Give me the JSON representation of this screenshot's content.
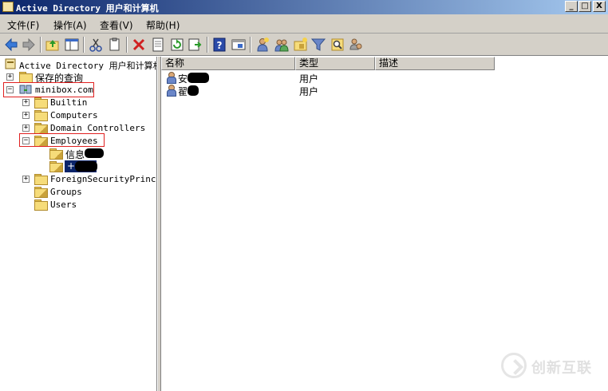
{
  "window": {
    "title": "Active Directory 用户和计算机",
    "buttons": {
      "minimize": "_",
      "maximize": "□",
      "close": "X"
    }
  },
  "menu": [
    "文件(F)",
    "操作(A)",
    "查看(V)",
    "帮助(H)"
  ],
  "toolbar": {
    "icons": [
      "back-arrow-icon",
      "forward-arrow-icon",
      "up-folder-icon",
      "show-hide-tree-icon",
      "cut-icon",
      "copy-icon",
      "delete-icon",
      "properties-icon",
      "refresh-icon",
      "export-list-icon",
      "help-icon",
      "mmc-console-icon",
      "new-user-icon",
      "new-group-icon",
      "new-ou-icon",
      "filter-icon",
      "find-icon",
      "add-to-group-icon"
    ]
  },
  "tree": {
    "root": "Active Directory 用户和计算机",
    "saved_queries": "保存的查询",
    "domain": "minibox.com",
    "children": [
      "Builtin",
      "Computers",
      "Domain Controllers",
      "Employees",
      "ForeignSecurityPrincipals",
      "Groups",
      "Users"
    ],
    "employees_children": [
      "信息",
      "+"
    ]
  },
  "list": {
    "columns": [
      "名称",
      "类型",
      "描述"
    ],
    "rows": [
      {
        "name": "安",
        "type": "用户",
        "desc": ""
      },
      {
        "name": "翟",
        "type": "用户",
        "desc": ""
      }
    ]
  },
  "watermark": {
    "text": "创新互联"
  },
  "colors": {
    "title_start": "#0a246a",
    "title_end": "#a6caf0",
    "chrome": "#d4d0c8",
    "selection": "#0a246a",
    "annotation": "#e02020"
  }
}
